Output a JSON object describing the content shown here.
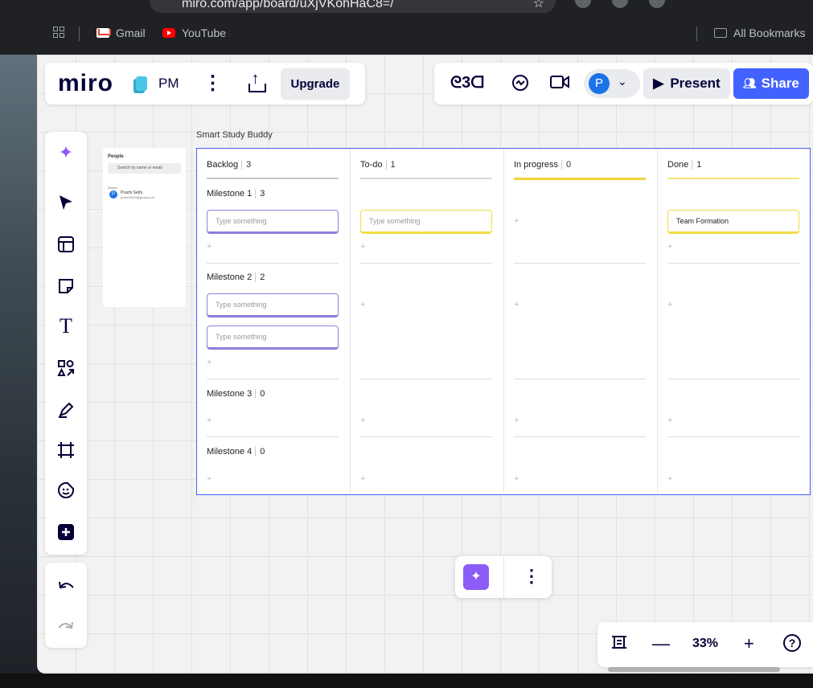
{
  "browser": {
    "url": "miro.com/app/board/uXjVKohHaC8=/",
    "bookmarks": [
      "Gmail",
      "YouTube"
    ],
    "all_bookmarks": "All Bookmarks"
  },
  "header": {
    "logo": "miro",
    "board_name": "PM",
    "upgrade": "Upgrade",
    "avatar_initial": "P",
    "present": "Present",
    "share": "Share",
    "reactions_glyph": "ᘓ3ᗡ"
  },
  "people_panel": {
    "title": "People",
    "search_placeholder": "Search by name or email",
    "online_label": "Online",
    "user_name": "Prachi Sethi",
    "user_email": "prachi1610@gmail.com",
    "user_initial": "P"
  },
  "board": {
    "frame_title": "Smart Study Buddy",
    "columns": [
      {
        "name": "Backlog",
        "count": "3"
      },
      {
        "name": "To-do",
        "count": "1"
      },
      {
        "name": "In progress",
        "count": "0"
      },
      {
        "name": "Done",
        "count": "1"
      }
    ],
    "milestones": [
      {
        "name": "Milestone 1",
        "count": "3"
      },
      {
        "name": "Milestone 2",
        "count": "2"
      },
      {
        "name": "Milestone 3",
        "count": "0"
      },
      {
        "name": "Milestone 4",
        "count": "0"
      }
    ],
    "card_placeholder": "Type something",
    "done_card": "Team Formation",
    "add_glyph": "+"
  },
  "zoom": {
    "value": "33%"
  },
  "colors": {
    "accent": "#4262ff",
    "purple_card": "#8b80d8",
    "yellow_card": "#f2dd47",
    "ai": "#8b5cf6"
  }
}
